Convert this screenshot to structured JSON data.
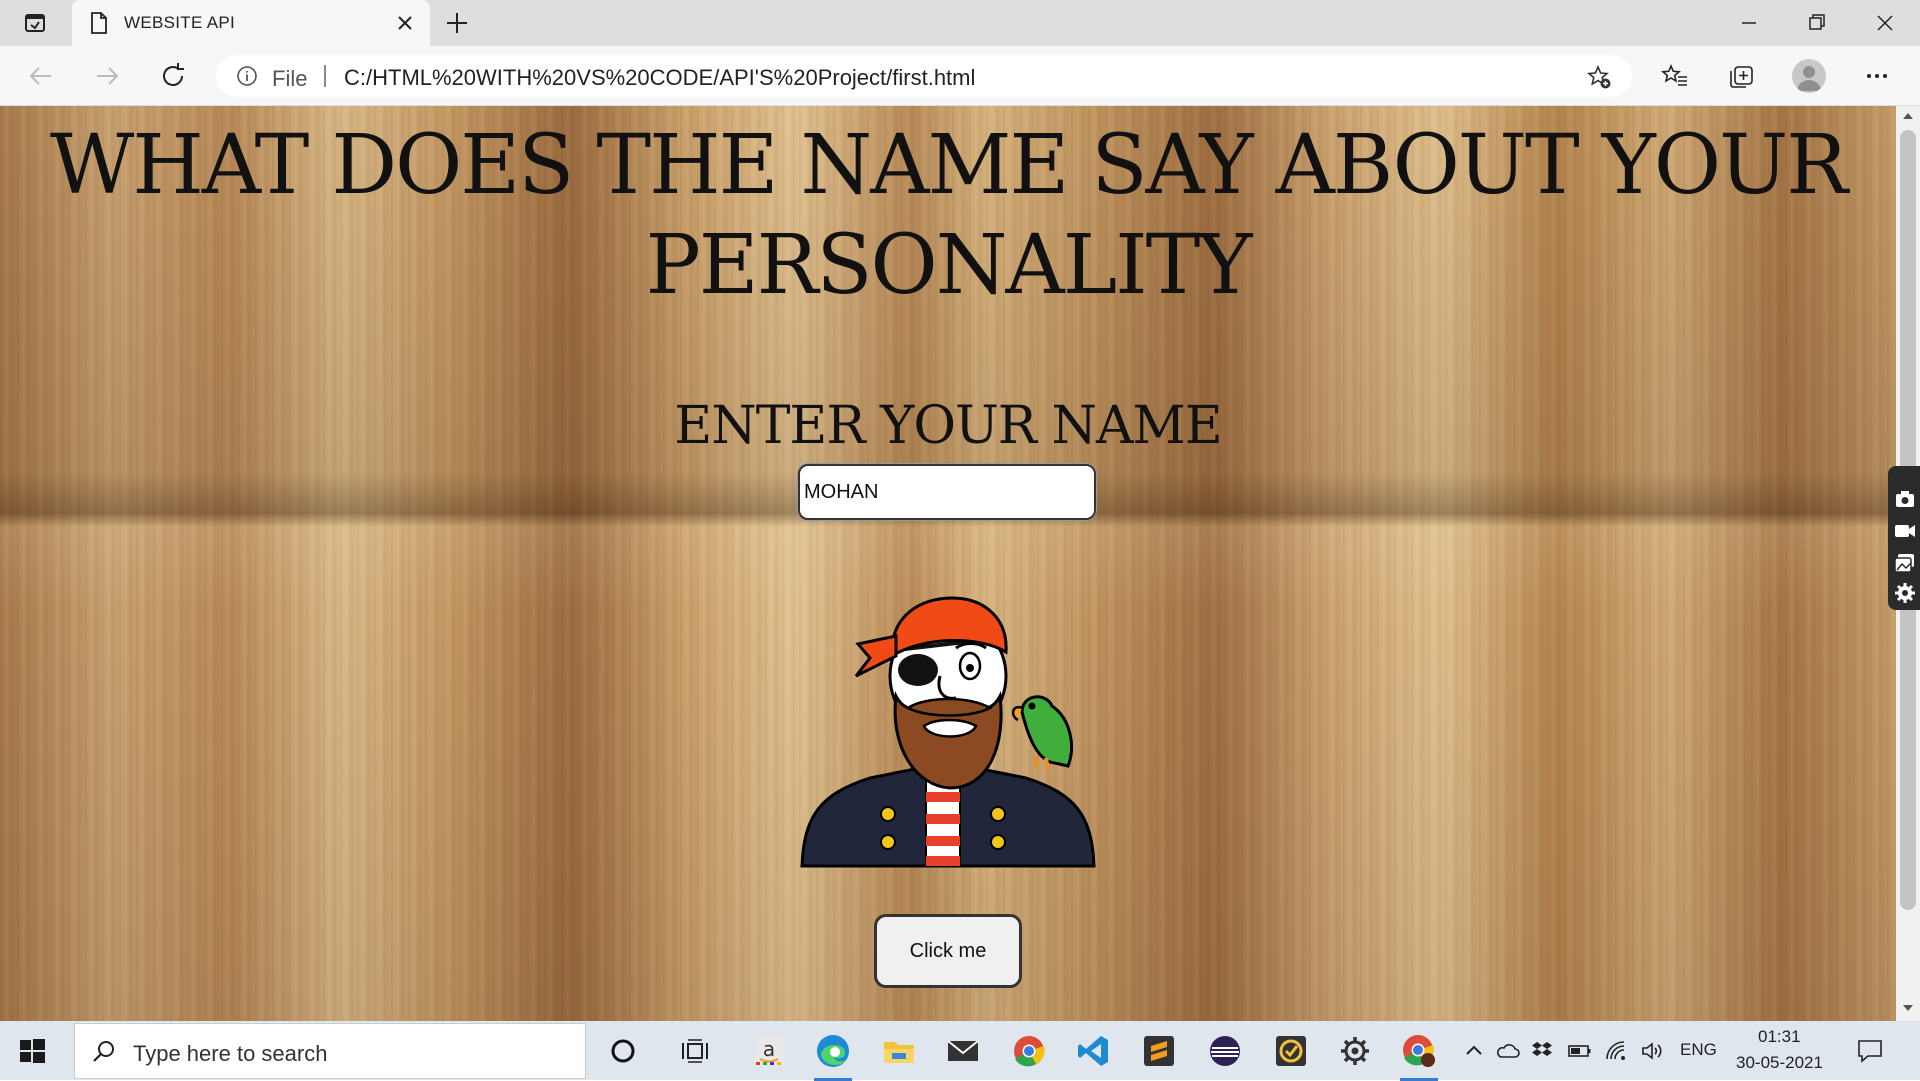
{
  "browser": {
    "tab_title": "WEBSITE API",
    "address_scheme_label": "File",
    "url": "C:/HTML%20WITH%20VS%20CODE/API'S%20Project/first.html"
  },
  "page": {
    "headline": "WHAT DOES THE NAME SAY ABOUT YOUR PERSONALITY",
    "prompt": "ENTER YOUR NAME",
    "name_value": "MOHAN",
    "button_label": "Click me"
  },
  "taskbar": {
    "search_placeholder": "Type here to search",
    "language": "ENG",
    "time": "01:31",
    "date": "30-05-2021",
    "apps": [
      "cortana-icon",
      "task-view-icon",
      "amazon-icon",
      "edge-icon",
      "file-explorer-icon",
      "mail-icon",
      "chrome-icon",
      "vscode-icon",
      "sublime-icon",
      "eclipse-icon",
      "tasks-icon",
      "settings-icon",
      "chrome-profile-icon"
    ]
  },
  "colors": {
    "bandana": "#f04a16",
    "coat": "#22263a",
    "parrot": "#3fae3a",
    "beard": "#8c4a22"
  }
}
